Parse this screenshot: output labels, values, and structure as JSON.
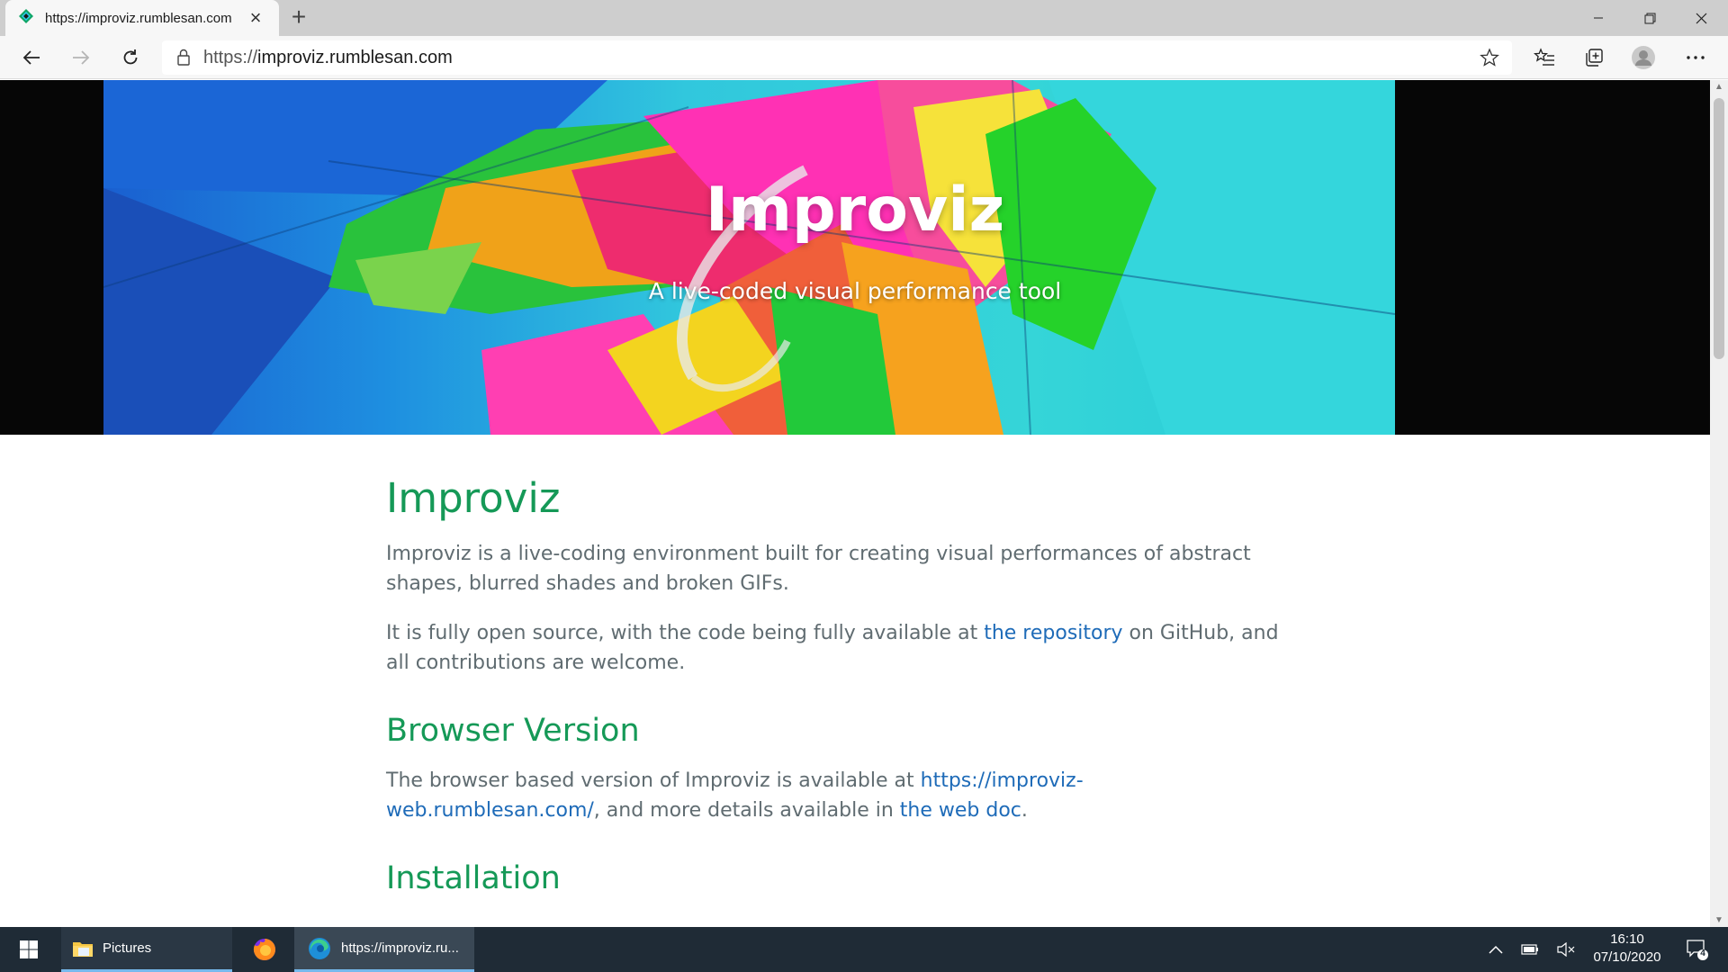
{
  "browser": {
    "tab_title": "https://improviz.rumblesan.com",
    "url_prefix": "https://",
    "url_domain": "improviz.rumblesan.com",
    "new_tab_label": "+"
  },
  "hero": {
    "title": "Improviz",
    "subtitle": "A live-coded visual performance tool"
  },
  "content": {
    "heading": "Improviz",
    "intro": "Improviz is a live-coding environment built for creating visual performances of abstract shapes, blurred shades and broken GIFs.",
    "open_source_before": "It is fully open source, with the code being fully available at ",
    "repo_link": "the repository",
    "open_source_after": " on GitHub, and all contributions are welcome.",
    "browser_heading": "Browser Version",
    "browser_before": "The browser based version of Improviz is available at ",
    "browser_link": "https://improviz-web.rumblesan.com/",
    "browser_middle": ", and more details available in ",
    "webdoc_link": "the web doc",
    "browser_after": ".",
    "install_heading": "Installation"
  },
  "taskbar": {
    "explorer_label": "Pictures",
    "edge_label": "https://improviz.ru...",
    "time": "16:10",
    "date": "07/10/2020",
    "notification_count": "4"
  },
  "colors": {
    "heading_green": "#159957",
    "link_blue": "#1e6bb8",
    "body_text": "#606c71",
    "taskbar": "#1f2b36"
  },
  "icons": {
    "tab_favicon": "improviz-favicon",
    "back": "arrow-left-icon",
    "forward": "arrow-right-icon",
    "refresh": "refresh-icon",
    "lock": "lock-icon",
    "favorite": "star-icon",
    "favorites": "favorites-list-icon",
    "collections": "collections-icon",
    "profile": "profile-icon",
    "menu": "more-icon"
  }
}
